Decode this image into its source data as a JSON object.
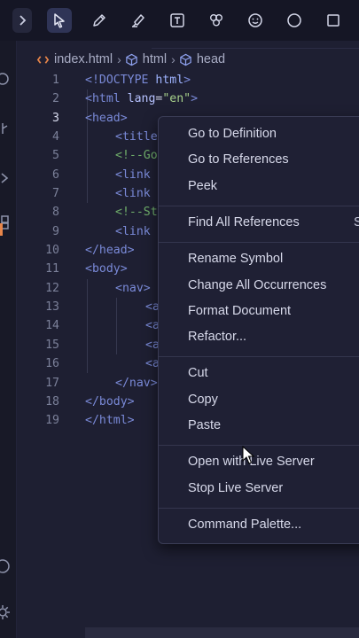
{
  "toolbar": {
    "tools": [
      "expand-icon",
      "select-icon",
      "pen-icon",
      "highlighter-icon",
      "text-icon",
      "palette-icon",
      "emoji-icon",
      "circle-icon",
      "square-icon"
    ],
    "active_tool": "select-icon"
  },
  "breadcrumb": {
    "file": "index.html",
    "path": [
      "html",
      "head"
    ]
  },
  "editor": {
    "current_line": 3,
    "lines": [
      {
        "n": "1",
        "text": "<!DOCTYPE html>"
      },
      {
        "n": "2",
        "text": "<html lang=\"en\">"
      },
      {
        "n": "3",
        "text": "<head>"
      },
      {
        "n": "4",
        "text": "<title"
      },
      {
        "n": "5",
        "text": "<!--Go"
      },
      {
        "n": "6",
        "text": "<link"
      },
      {
        "n": "7",
        "text": "<link"
      },
      {
        "n": "8",
        "text": "<!--St"
      },
      {
        "n": "9",
        "text": "<link"
      },
      {
        "n": "10",
        "text": "</head>"
      },
      {
        "n": "11",
        "text": "<body>"
      },
      {
        "n": "12",
        "text": "<nav>"
      },
      {
        "n": "13",
        "text": "<a"
      },
      {
        "n": "14",
        "text": "<a"
      },
      {
        "n": "15",
        "text": "<a"
      },
      {
        "n": "16",
        "text": "<a"
      },
      {
        "n": "17",
        "text": "</nav>"
      },
      {
        "n": "18",
        "text": "</body>"
      },
      {
        "n": "19",
        "text": "</html>"
      }
    ]
  },
  "context_menu": {
    "groups": [
      [
        {
          "label": "Go to Definition"
        },
        {
          "label": "Go to References"
        },
        {
          "label": "Peek"
        }
      ],
      [
        {
          "label": "Find All References",
          "shortcut": "S"
        }
      ],
      [
        {
          "label": "Rename Symbol"
        },
        {
          "label": "Change All Occurrences"
        },
        {
          "label": "Format Document"
        },
        {
          "label": "Refactor..."
        }
      ],
      [
        {
          "label": "Cut"
        },
        {
          "label": "Copy"
        },
        {
          "label": "Paste"
        }
      ],
      [
        {
          "label": "Open with Live Server"
        },
        {
          "label": "Stop Live Server"
        }
      ],
      [
        {
          "label": "Command Palette..."
        }
      ]
    ]
  },
  "colors": {
    "background": "#1b1b2b",
    "editor_bg": "#1e1f32",
    "menu_bg": "#1f2034",
    "tag": "#7a8ad8",
    "keyword": "#9fb4ff",
    "string": "#a7d18b",
    "comment": "#6fae6a",
    "file_icon": "#e8864a"
  }
}
